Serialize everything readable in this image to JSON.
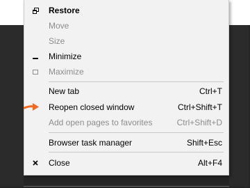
{
  "menu": {
    "restore": {
      "label": "Restore",
      "icon": "restore-icon"
    },
    "move": {
      "label": "Move"
    },
    "size": {
      "label": "Size"
    },
    "minimize": {
      "label": "Minimize",
      "icon": "minimize-icon"
    },
    "maximize": {
      "label": "Maximize",
      "icon": "maximize-icon"
    },
    "new_tab": {
      "label": "New tab",
      "shortcut": "Ctrl+T"
    },
    "reopen": {
      "label": "Reopen closed window",
      "shortcut": "Ctrl+Shift+T"
    },
    "add_favorites": {
      "label": "Add open pages to favorites",
      "shortcut": "Ctrl+Shift+D"
    },
    "task_manager": {
      "label": "Browser task manager",
      "shortcut": "Shift+Esc"
    },
    "close": {
      "label": "Close",
      "shortcut": "Alt+F4",
      "icon": "close-icon"
    }
  },
  "colors": {
    "menu_bg": "#f2f2f2",
    "disabled_text": "#8d8d8d",
    "annotation_arrow": "#f26a21"
  }
}
